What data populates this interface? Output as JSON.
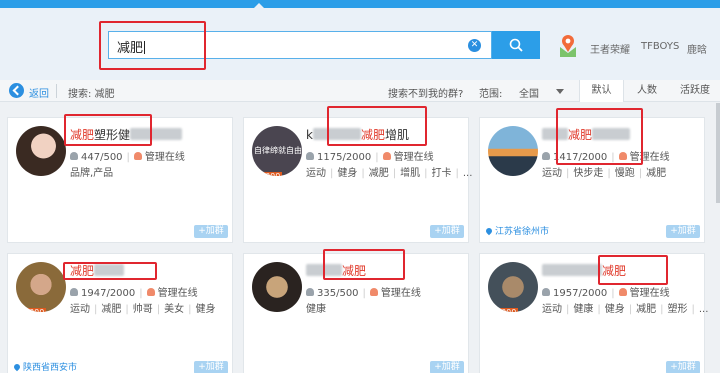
{
  "search": {
    "value": "减肥"
  },
  "hot_searches": [
    "王者荣耀",
    "TFBOYS",
    "鹿晗"
  ],
  "nav": {
    "back_label": "返回",
    "search_keyword": "搜索: 减肥",
    "cant_find": "搜索不到我的群?",
    "range_label": "范围:",
    "range_value": "全国",
    "tabs": [
      "默认",
      "人数",
      "活跃度"
    ]
  },
  "groups": [
    {
      "name_pre": "",
      "name_hl": "减肥",
      "name_post": "塑形健",
      "level": "",
      "members": "447/500",
      "admin": "管理在线",
      "tags": [
        "品牌,产品"
      ],
      "location": "",
      "join": "+加群"
    },
    {
      "name_pre": "k",
      "name_hl": "减肥",
      "name_post": "增肌",
      "level": "2000",
      "avatar_text": "自律缔就自由",
      "members": "1175/2000",
      "admin": "管理在线",
      "tags": [
        "运动",
        "健身",
        "减肥",
        "增肌",
        "打卡",
        "..."
      ],
      "location": "",
      "join": "+加群"
    },
    {
      "name_pre": "",
      "name_hl": "减肥",
      "name_post": "",
      "level": "",
      "members": "1417/2000",
      "admin": "管理在线",
      "tags": [
        "运动",
        "快步走",
        "慢跑",
        "减肥"
      ],
      "location": "江苏省徐州市",
      "join": "+加群"
    },
    {
      "name_pre": "",
      "name_hl": "减肥",
      "name_post": "",
      "level": "2000",
      "members": "1947/2000",
      "admin": "管理在线",
      "tags": [
        "运动",
        "减肥",
        "帅哥",
        "美女",
        "健身"
      ],
      "location": "陕西省西安市",
      "join": "+加群"
    },
    {
      "name_pre": "",
      "name_hl": "减肥",
      "name_post": "",
      "level": "",
      "members": "335/500",
      "admin": "管理在线",
      "tags": [
        "健康"
      ],
      "location": "",
      "join": "+加群"
    },
    {
      "name_pre": "",
      "name_hl": "减肥",
      "name_post": "",
      "level": "2000",
      "members": "1957/2000",
      "admin": "管理在线",
      "tags": [
        "运动",
        "健康",
        "健身",
        "减肥",
        "塑形",
        "..."
      ],
      "location": "",
      "join": "+加群"
    }
  ]
}
